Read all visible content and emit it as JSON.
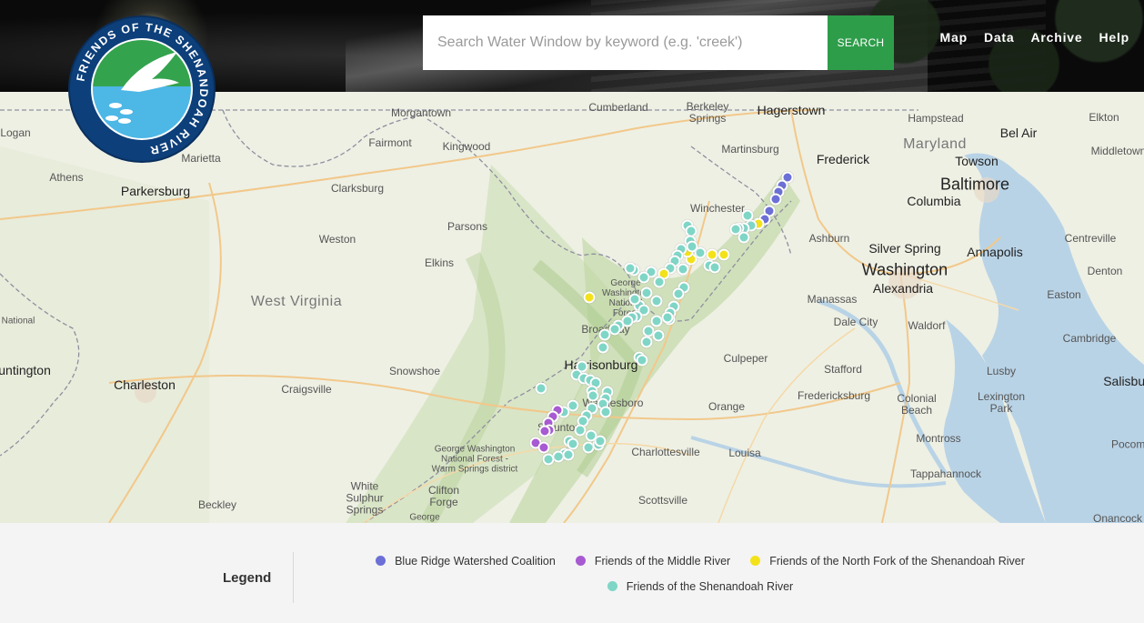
{
  "logo": {
    "text": "FRIENDS OF THE SHENANDOAH RIVER"
  },
  "search": {
    "placeholder": "Search Water Window by keyword (e.g. 'creek')",
    "value": "",
    "button_label": "SEARCH"
  },
  "nav": {
    "items": [
      {
        "label": "Map"
      },
      {
        "label": "Data"
      },
      {
        "label": "Archive"
      },
      {
        "label": "Help"
      }
    ]
  },
  "map": {
    "state_labels": [
      "West Virginia",
      "Maryland"
    ],
    "place_labels": [
      "Hagerstown",
      "Cumberland",
      "Berkeley Springs",
      "Hampstead",
      "Elkton",
      "Morgantown",
      "Logan",
      "Fairmont",
      "Kingwood",
      "Marietta",
      "Martinsburg",
      "Frederick",
      "Bel Air",
      "Middletown",
      "Athens",
      "Parkersburg",
      "Clarksburg",
      "Towson",
      "Baltimore",
      "Columbia",
      "Winchester",
      "Parsons",
      "Weston",
      "Ashburn",
      "Silver Spring",
      "Annapolis",
      "Centreville",
      "Elkins",
      "Washington",
      "Alexandria",
      "Denton",
      "National",
      "Manassas",
      "Easton",
      "Dale City",
      "Waldorf",
      "Cambridge",
      "Harrisonburg",
      "Culpeper",
      "Huntington",
      "Charleston",
      "Snowshoe",
      "Stafford",
      "Lusby",
      "Salisbury",
      "Craigsville",
      "Fredericksburg",
      "Colonial Beach",
      "Lexington Park",
      "Orange",
      "Charlottesville",
      "Louisa",
      "Montross",
      "Pocomoke",
      "Tappahannock",
      "White Sulphur Springs",
      "Clifton Forge",
      "Beckley",
      "Scottsville",
      "Onancock",
      "George",
      "George Washington National Forest",
      "Broadway",
      "Staunton",
      "Waynesboro",
      "George Washington National Forest - Warm Springs district"
    ]
  },
  "legend": {
    "title": "Legend",
    "items": [
      {
        "label": "Blue Ridge Watershed Coalition",
        "color": "#6b6fd6"
      },
      {
        "label": "Friends of the Middle River",
        "color": "#a85ad2"
      },
      {
        "label": "Friends of the North Fork of the Shenandoah River",
        "color": "#f3e21a"
      },
      {
        "label": "Friends of the Shenandoah River",
        "color": "#7fd6c6"
      }
    ]
  }
}
